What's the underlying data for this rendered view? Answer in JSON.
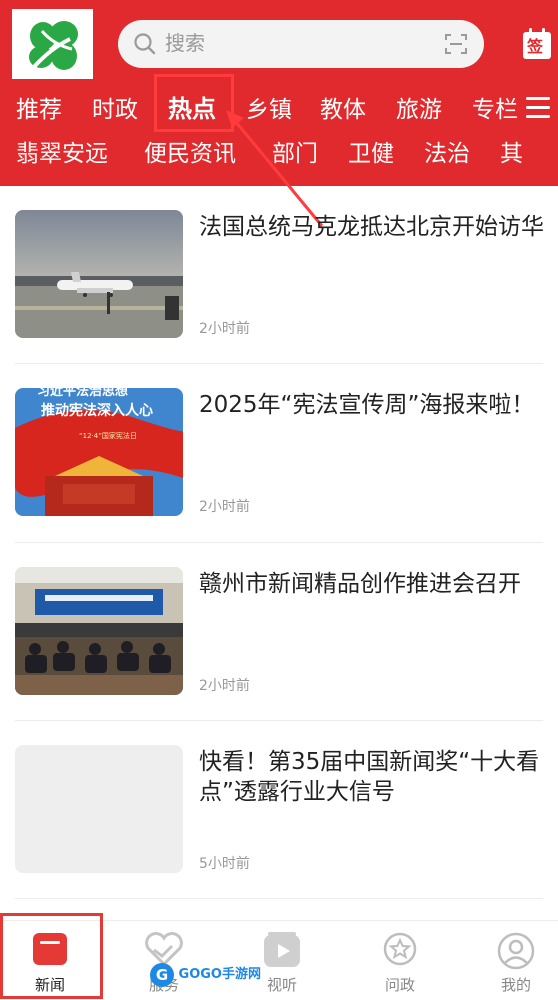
{
  "search": {
    "placeholder": "搜索"
  },
  "sign_label": "签",
  "tabs_row1": [
    {
      "label": "推荐",
      "active": false
    },
    {
      "label": "时政",
      "active": false
    },
    {
      "label": "热点",
      "active": true
    },
    {
      "label": "乡镇",
      "active": false
    },
    {
      "label": "教体",
      "active": false
    },
    {
      "label": "旅游",
      "active": false
    },
    {
      "label": "专栏",
      "active": false
    }
  ],
  "tabs_row2": [
    {
      "label": "翡翠安远"
    },
    {
      "label": "便民资讯"
    },
    {
      "label": "部门"
    },
    {
      "label": "卫健"
    },
    {
      "label": "法治"
    },
    {
      "label": "其"
    }
  ],
  "news": [
    {
      "title": "法国总统马克龙抵达北京开始访华",
      "time": "2小时前",
      "thumb": "airplane-photo"
    },
    {
      "title": "2025年“宪法宣传周”海报来啦！",
      "time": "2小时前",
      "thumb": "constitution-poster",
      "thumb_text_1": "习近平法治思想",
      "thumb_text_2": "推动宪法深入人心",
      "thumb_text_3": "“12·4”国家宪法日"
    },
    {
      "title": "赣州市新闻精品创作推进会召开",
      "time": "2小时前",
      "thumb": "meeting-photo"
    },
    {
      "title": "快看！第35届中国新闻奖“十大看点”透露行业大信号",
      "time": "5小时前",
      "thumb": "placeholder"
    }
  ],
  "bottom_tabs": [
    {
      "label": "新闻",
      "icon": "news-icon",
      "active": true
    },
    {
      "label": "服务",
      "icon": "service-icon",
      "active": false
    },
    {
      "label": "视听",
      "icon": "video-icon",
      "active": false
    },
    {
      "label": "问政",
      "icon": "star-icon",
      "active": false
    },
    {
      "label": "我的",
      "icon": "profile-icon",
      "active": false
    }
  ],
  "watermark": "GOGO手游网",
  "colors": {
    "brand_red": "#e02a2d",
    "highlight_red": "#ff3b3b",
    "logo_green": "#2aa845"
  }
}
